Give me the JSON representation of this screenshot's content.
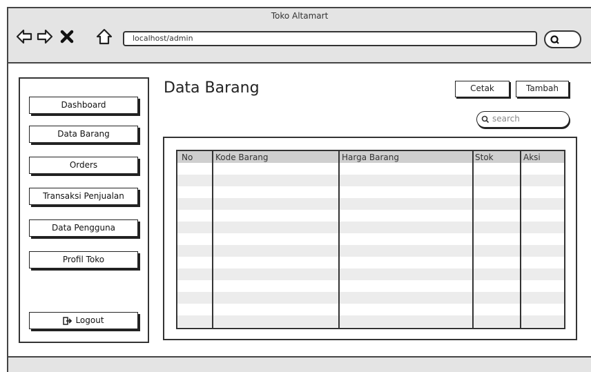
{
  "window": {
    "title": "Toko Altamart",
    "url": "localhost/admin"
  },
  "sidebar": {
    "items": [
      {
        "label": "Dashboard"
      },
      {
        "label": "Data Barang"
      },
      {
        "label": "Orders"
      },
      {
        "label": "Transaksi Penjualan"
      },
      {
        "label": "Data Pengguna"
      },
      {
        "label": "Profil Toko"
      }
    ],
    "logout_label": "Logout"
  },
  "main": {
    "title": "Data Barang",
    "print_label": "Cetak",
    "add_label": "Tambah",
    "search_placeholder": "search",
    "table": {
      "columns": [
        "No",
        "Kode Barang",
        "Harga Barang",
        "Stok",
        "Aksi"
      ]
    }
  }
}
